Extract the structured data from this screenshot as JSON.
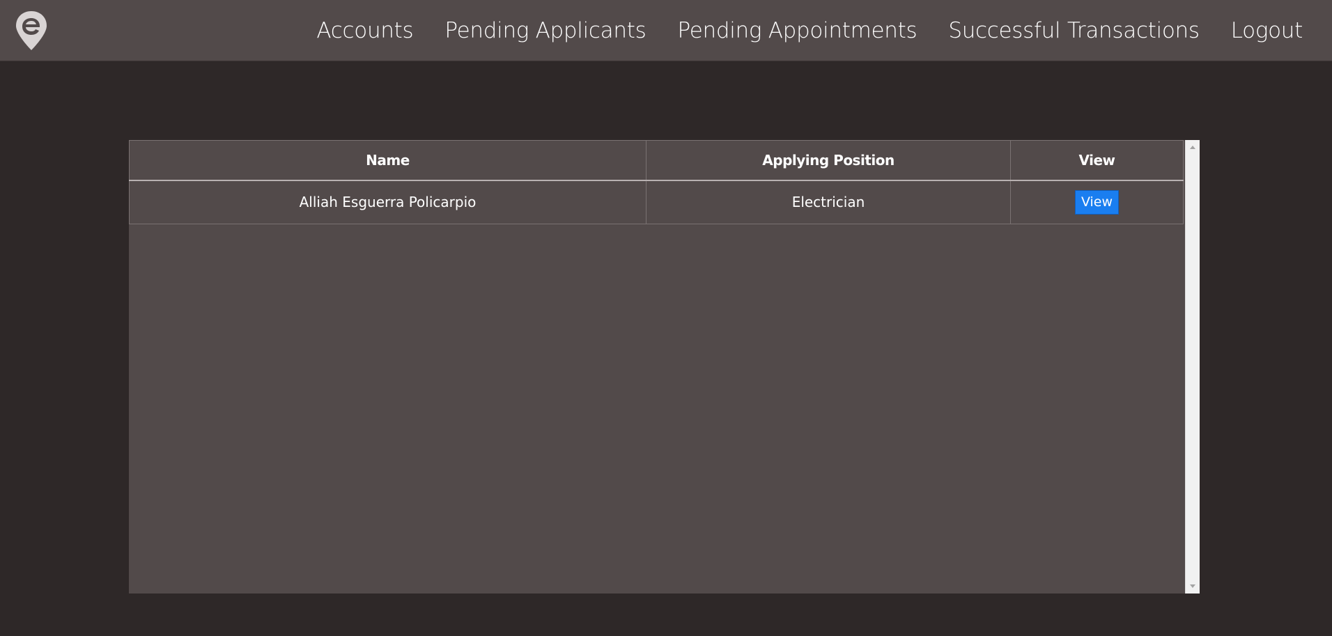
{
  "nav": {
    "logo_icon": "location-pin-e-logo",
    "links": [
      {
        "label": "Accounts"
      },
      {
        "label": "Pending Applicants"
      },
      {
        "label": "Pending Appointments"
      },
      {
        "label": "Successful Transactions"
      },
      {
        "label": "Logout"
      }
    ]
  },
  "table": {
    "headers": [
      "Name",
      "Applying Position",
      "View"
    ],
    "rows": [
      {
        "name": "Alliah Esguerra Policarpio",
        "position": "Electrician",
        "action_label": "View"
      }
    ]
  },
  "colors": {
    "navbar_bg": "#524a4a",
    "page_bg": "#2e2828",
    "panel_bg": "#524a4a",
    "button_bg": "#1a7ef0"
  }
}
